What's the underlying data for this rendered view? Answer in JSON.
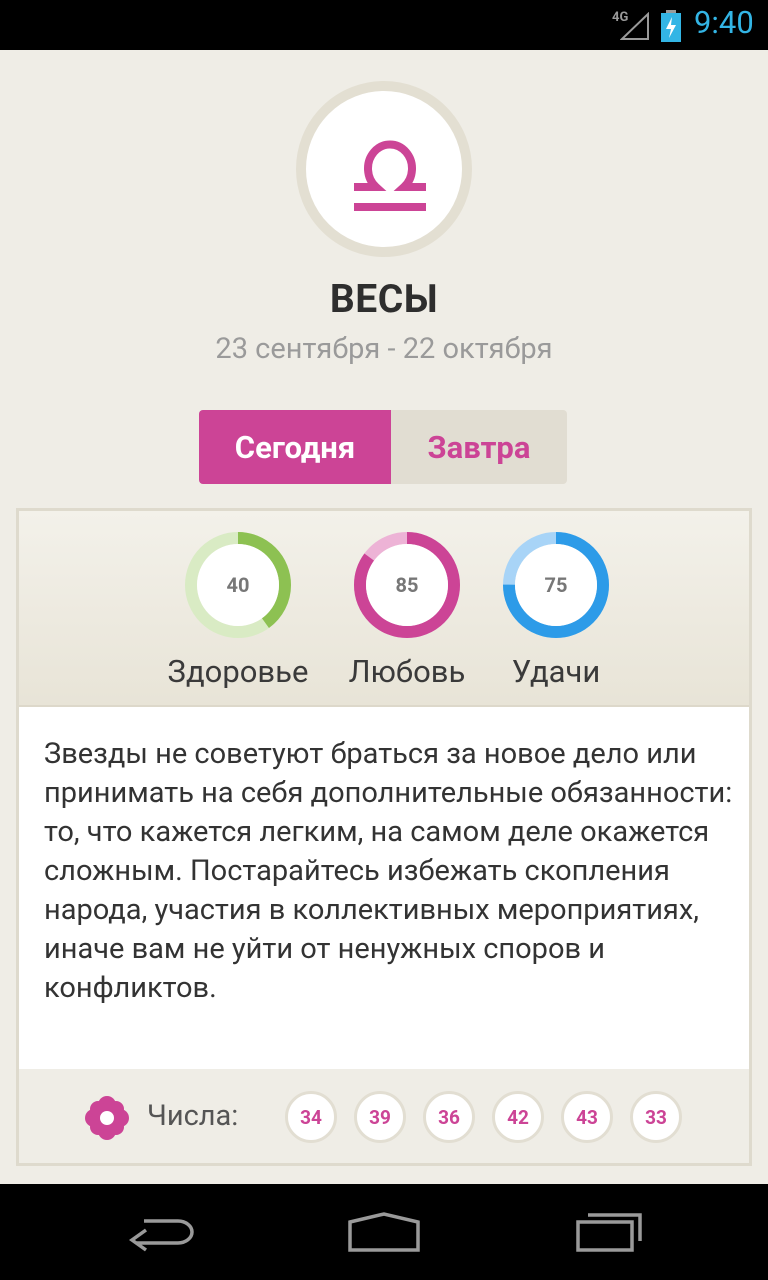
{
  "status_bar": {
    "network": "4G",
    "time": "9:40"
  },
  "sign": {
    "name": "ВЕСЫ",
    "dates": "23 сентября - 22 октября",
    "icon": "libra-icon"
  },
  "tabs": {
    "today": "Сегодня",
    "tomorrow": "Завтра",
    "active": "today"
  },
  "stats": [
    {
      "label": "Здоровье",
      "value": "40",
      "fraction": 0.4,
      "color": "#8dc152",
      "track": "#d9ebc4"
    },
    {
      "label": "Любовь",
      "value": "85",
      "fraction": 0.85,
      "color": "#cc4496",
      "track": "#edb3d6"
    },
    {
      "label": "Удачи",
      "value": "75",
      "fraction": 0.75,
      "color": "#2d9be8",
      "track": "#a8d4f7"
    }
  ],
  "forecast_text": "Звезды не советуют браться за новое дело или принимать на себя дополнительные обязанности: то, что кажется легким, на самом деле окажется сложным. Постарайтесь избежать скопления народа, участия в коллективных мероприятиях, иначе вам не уйти от ненужных споров и конфликтов.",
  "numbers": {
    "label": "Числа:",
    "icon": "flower-icon",
    "values": [
      "34",
      "39",
      "36",
      "42",
      "43",
      "33"
    ]
  },
  "nav": {
    "back_icon": "back-icon",
    "home_icon": "home-icon",
    "recents_icon": "recents-icon"
  },
  "colors": {
    "accent": "#cc4496",
    "background": "#efede6"
  }
}
